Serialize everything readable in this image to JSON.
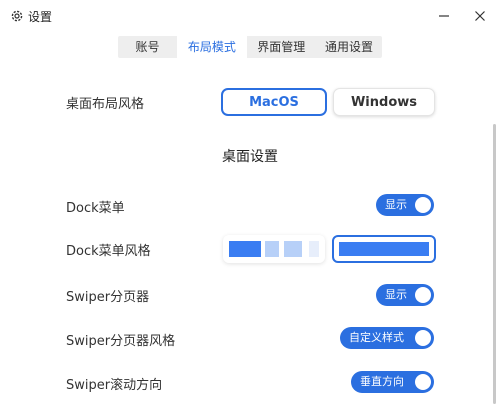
{
  "window": {
    "title": "设置",
    "icons": {
      "app": "gear-icon",
      "minimize": "minimize-icon",
      "close": "close-icon"
    }
  },
  "tabs": [
    {
      "label": "账号",
      "active": false
    },
    {
      "label": "布局模式",
      "active": true
    },
    {
      "label": "界面管理",
      "active": false
    },
    {
      "label": "通用设置",
      "active": false
    }
  ],
  "desktop_layout": {
    "label": "桌面布局风格",
    "options": [
      {
        "label": "MacOS",
        "selected": true
      },
      {
        "label": "Windows",
        "selected": false
      }
    ]
  },
  "section_title": "桌面设置",
  "settings": {
    "dock_menu": {
      "label": "Dock菜单",
      "toggle_text": "显示",
      "on": true
    },
    "dock_style": {
      "label": "Dock菜单风格",
      "selected_option": 2
    },
    "swiper_pager": {
      "label": "Swiper分页器",
      "toggle_text": "显示",
      "on": true
    },
    "swiper_pager_style": {
      "label": "Swiper分页器风格",
      "toggle_text": "自定义样式",
      "on": true
    },
    "swiper_direction": {
      "label": "Swiper滚动方向",
      "toggle_text": "垂直方向",
      "on": true
    }
  },
  "colors": {
    "accent": "#2b6fe0",
    "block": "#3a7df2",
    "block_light": "#b7d0f8",
    "tab_bg": "#eeeeee"
  }
}
